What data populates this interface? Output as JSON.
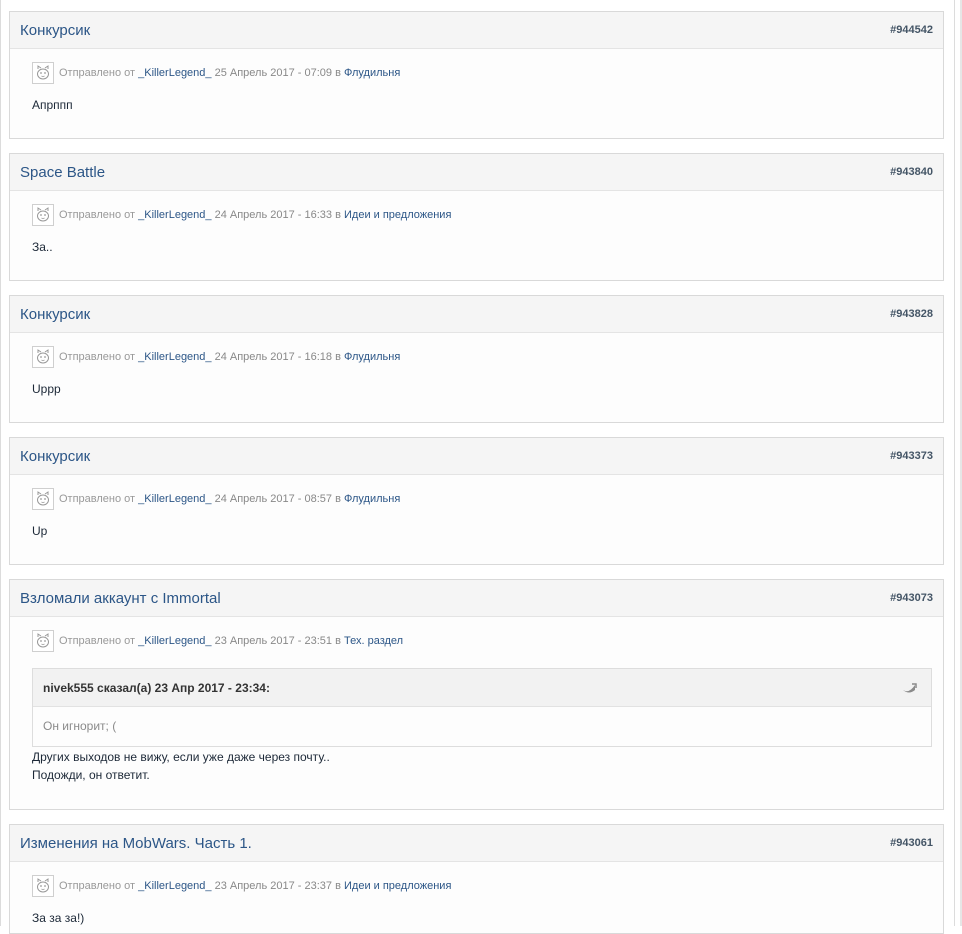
{
  "posts": [
    {
      "title": "Конкурсик",
      "number": "#944542",
      "sent_label": "Отправлено от",
      "author": "_KillerLegend_",
      "date": "25 Апрель 2017 - 07:09",
      "in_label": "в",
      "forum": "Флудильня",
      "content": "Апpппп"
    },
    {
      "title": "Space Battle",
      "number": "#943840",
      "sent_label": "Отправлено от",
      "author": "_KillerLegend_",
      "date": "24 Апрель 2017 - 16:33",
      "in_label": "в",
      "forum": "Идеи и предложения",
      "content": "За.."
    },
    {
      "title": "Конкурсик",
      "number": "#943828",
      "sent_label": "Отправлено от",
      "author": "_KillerLegend_",
      "date": "24 Апрель 2017 - 16:18",
      "in_label": "в",
      "forum": "Флудильня",
      "content": "Uppp"
    },
    {
      "title": "Конкурсик",
      "number": "#943373",
      "sent_label": "Отправлено от",
      "author": "_KillerLegend_",
      "date": "24 Апрель 2017 - 08:57",
      "in_label": "в",
      "forum": "Флудильня",
      "content": "Up"
    },
    {
      "title": "Взломали аккаунт с Immortal",
      "number": "#943073",
      "sent_label": "Отправлено от",
      "author": "_KillerLegend_",
      "date": "23 Апрель 2017 - 23:51",
      "in_label": "в",
      "forum": "Тех. раздел",
      "quote_author": "nivek555 сказал(а) 23 Апр 2017 - 23:34:",
      "quote_text": "Он игнорит; (",
      "content_line1": "Других выходов не вижу, если уже даже через почту..",
      "content_line2": "Подожди, он ответит."
    },
    {
      "title": "Изменения на MobWars. Часть 1.",
      "number": "#943061",
      "sent_label": "Отправлено от",
      "author": "_KillerLegend_",
      "date": "23 Апрель 2017 - 23:37",
      "in_label": "в",
      "forum": "Идеи и предложения",
      "content": "За за за!)"
    }
  ],
  "icons": {
    "avatar": "avatar-face-icon",
    "quote": "quote-return-icon"
  }
}
